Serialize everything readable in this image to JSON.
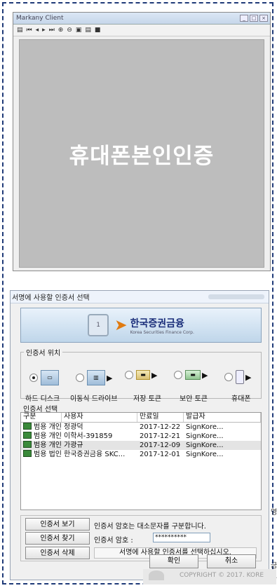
{
  "viewer": {
    "title": "Markany Client",
    "toolbar": [
      "▤",
      "⏮",
      "◂",
      "▸",
      "⏭",
      "⊕",
      "⊖",
      "▣",
      "▤",
      "■"
    ],
    "overlay_text": "휴대폰본인인증"
  },
  "dialog": {
    "title": "서명에 사용할 인증서 선택",
    "brand_ko": "한국증권금융",
    "brand_en": "Korea Securities Finance Corp.",
    "location_legend": "인증서 위치",
    "devices": [
      {
        "label": "하드 디스크",
        "selected": true
      },
      {
        "label": "이동식 드라이브",
        "selected": false
      },
      {
        "label": "저장 토큰",
        "selected": false
      },
      {
        "label": "보안 토큰",
        "selected": false
      },
      {
        "label": "휴대폰",
        "selected": false
      }
    ],
    "list_label": "인증서 선택",
    "columns": [
      "구분",
      "사용자",
      "만료일",
      "발급자"
    ],
    "rows": [
      {
        "type": "범용 개인",
        "user": "정광덕",
        "expiry": "2017-12-22",
        "issuer": "SignKore..."
      },
      {
        "type": "범용 개인",
        "user": "이학서-391859",
        "expiry": "2017-12-21",
        "issuer": "SignKore..."
      },
      {
        "type": "범용 개인",
        "user": "가광규",
        "expiry": "2017-12-09",
        "issuer": "SignKore..."
      },
      {
        "type": "범용 법인",
        "user": "한국증권금융 SKC...",
        "expiry": "2017-12-01",
        "issuer": "SignKore..."
      }
    ],
    "view_btn": "인증서 보기",
    "find_btn": "인증서 찾기",
    "delete_btn": "인증서 삭제",
    "case_hint": "인증서 암호는 대소문자를 구분합니다.",
    "pw_label": "인증서 암호 :",
    "pw_value": "**********",
    "status": "서명에 사용할 인증서를 선택하십시오.",
    "ok_btn": "확인",
    "cancel_btn": "취소"
  },
  "background": {
    "side_text_1": "영",
    "side_text_2": "금고",
    "copyright": "COPYRIGHT © 2017. KORE"
  }
}
